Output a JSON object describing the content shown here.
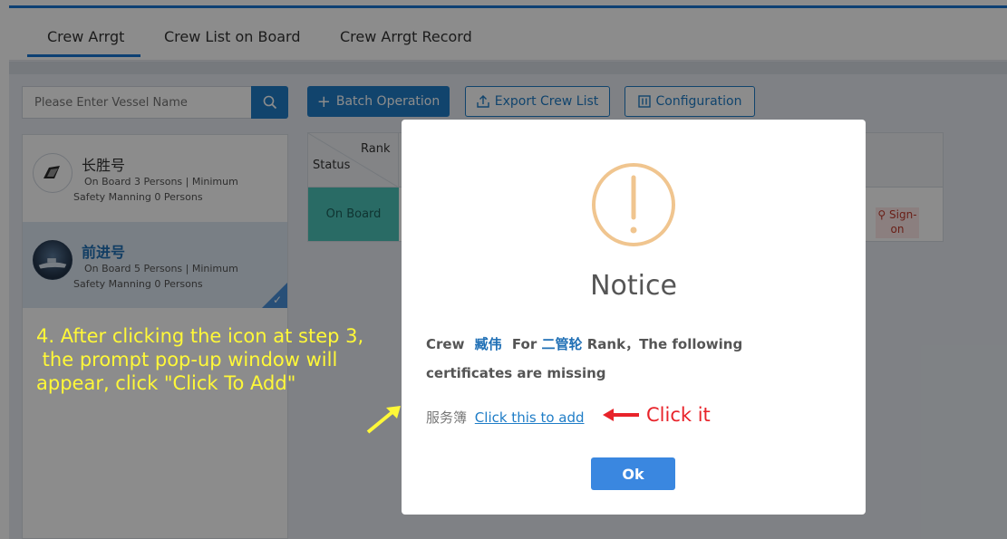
{
  "tabs": [
    {
      "label": "Crew Arrgt",
      "active": true
    },
    {
      "label": "Crew List on Board",
      "active": false
    },
    {
      "label": "Crew Arrgt Record",
      "active": false
    }
  ],
  "search": {
    "placeholder": "Please Enter Vessel Name",
    "icon": "search-icon"
  },
  "toolbar": {
    "batch_label": "Batch Operation",
    "export_label": "Export Crew List",
    "config_label": "Configuration"
  },
  "vessels": [
    {
      "name": "长胜号",
      "info_line1": "On Board 3 Persons | Minimum",
      "info_line2": "Safety Manning 0 Persons",
      "selected": false
    },
    {
      "name": "前进号",
      "info_line1": "On Board 5 Persons | Minimum",
      "info_line2": "Safety Manning 0 Persons",
      "selected": true
    }
  ],
  "table": {
    "rank_header": "Rank",
    "status_header": "Status",
    "row_status": "On Board",
    "signon_label": "Sign-on"
  },
  "annotation": {
    "line1": "4. After clicking the icon at step 3,",
    "line2": " the prompt pop-up window will",
    "line3": "appear, click \"Click To Add\""
  },
  "modal": {
    "title": "Notice",
    "msg_prefix": "Crew",
    "crew_name": "臧伟",
    "msg_for": "For",
    "rank_name": "二管轮",
    "msg_suffix": "Rank，The following",
    "msg_line2": "certificates are missing",
    "missing_cert": "服务簿",
    "add_link": "Click this to add",
    "click_hint": "Click it",
    "ok_label": "Ok"
  },
  "colors": {
    "accent": "#1f7dc7",
    "warning": "#f0c58f",
    "annotation": "#fff838",
    "hint_red": "#e8232a"
  }
}
